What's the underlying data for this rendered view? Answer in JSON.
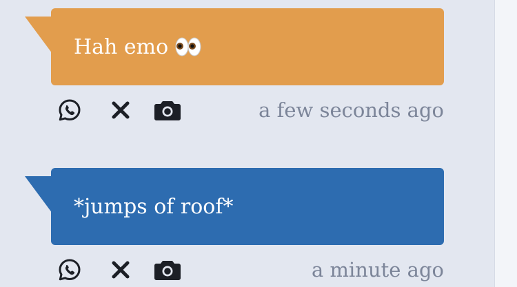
{
  "colors": {
    "background": "#e3e7f0",
    "bubble_orange": "#e29d4d",
    "bubble_blue": "#2d6cb0",
    "icon": "#1c1f26",
    "timestamp": "#7c8599"
  },
  "messages": [
    {
      "text": "Hah emo",
      "emoji": "eyes-emoji",
      "bubble_color": "#e29d4d",
      "timestamp": "a few seconds ago",
      "actions": [
        "whatsapp-icon",
        "close-icon",
        "camera-icon"
      ]
    },
    {
      "text": "*jumps of roof*",
      "bubble_color": "#2d6cb0",
      "timestamp": "a minute ago",
      "actions": [
        "whatsapp-icon",
        "close-icon",
        "camera-icon"
      ]
    }
  ]
}
